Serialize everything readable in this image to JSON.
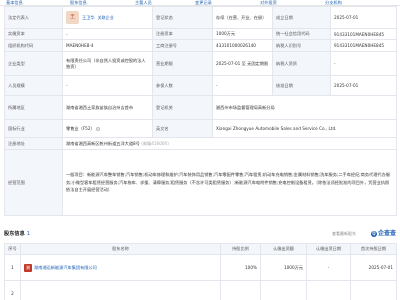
{
  "tabs": [
    "基本信息",
    "股东信息",
    "主要人员",
    "变更记录",
    "对外投资",
    "分支机构"
  ],
  "info": {
    "legal_rep_label": "法定代表人",
    "legal_rep_avatar": "王",
    "legal_rep_name": "王卫华",
    "legal_rep_tag": "关联企业",
    "status_label": "登记状态",
    "status_value": "存续（在营、开业、在册）",
    "est_date_label": "成立日期",
    "est_date_value": "2025-07-01",
    "reg_capital_label": "注册资本",
    "reg_capital_value": "1000万元",
    "paid_capital_label": "实缴资本",
    "paid_capital_value": "-",
    "credit_code_label": "统一社会信用代码",
    "credit_code_value": "91433101MAEN0HE845",
    "org_code_label": "组织机构代码",
    "org_code_value": "MAEN0HE8-4",
    "reg_no_label": "工商注册号",
    "reg_no_value": "433101000026140",
    "taxpayer_no_label": "纳税人识别号",
    "taxpayer_no_value": "91433101MAEN0HE845",
    "company_type_label": "企业类型",
    "company_type_value": "有限责任公司（非自然人投资或控股的法人独资）",
    "term_label": "营业期限",
    "term_value": "2025-07-01 至 无固定期限",
    "taxpayer_qual_label": "纳税人资质",
    "taxpayer_qual_value": "-",
    "staff_label": "人员规模",
    "staff_value": "-",
    "insured_label": "参保人数",
    "insured_value": "-",
    "approval_label": "核准日期",
    "approval_value": "2025-07-01",
    "region_label": "所属地区",
    "region_value": "湖南省湘西土家族苗族自治州吉首市",
    "authority_label": "登记机关",
    "authority_value": "湘西州市场监督管理局高新分局",
    "industry_label": "国标行业",
    "industry_value": "零售业（F52）",
    "en_name_label": "英文名",
    "en_name_value": "Xiangxi Zhongyue Automobile Sales and Service Co., Ltd.",
    "address_label": "注册地址",
    "address_value": "湖南省湘西高新区乾州街道五洋大道8号",
    "address_extra": "(邮编416000)",
    "scope_label": "经营范围",
    "scope_value": "一般项目：新能源汽车整车销售;汽车销售;机动车修理和维护;汽车装饰用品销售;汽车零配件零售;汽车租赁;机动车充电销售;金属材料销售;洗车服务;二手车经纪;商务代理代办服务;小微型客车租赁经营服务;汽车拖车、求援、清障服务;租赁服务（不含许可类租赁服务）;新能源汽车电附件销售;充电控制设备租赁。（除依法须经批准的项目外，凭营业执照依法自主开展经营活动）"
  },
  "shareholders": {
    "title": "股东信息",
    "count": "1",
    "right_note": "查看最新股东",
    "brand": "企查查",
    "headers": [
      "序号",
      "股东名称",
      "持股比例",
      "认缴出资额",
      "认缴出资日期",
      "首次持股日期"
    ],
    "rows": [
      {
        "idx": "1",
        "logo": "湘",
        "name": "湖南湘运新能源汽车集团有限公司",
        "ratio": "100%",
        "amount": "1000万元",
        "date": "-",
        "first_date": "2025-07-01"
      },
      {
        "idx": "2",
        "logo": "",
        "name": "",
        "ratio": "",
        "amount": "",
        "date": "",
        "first_date": ""
      }
    ]
  }
}
